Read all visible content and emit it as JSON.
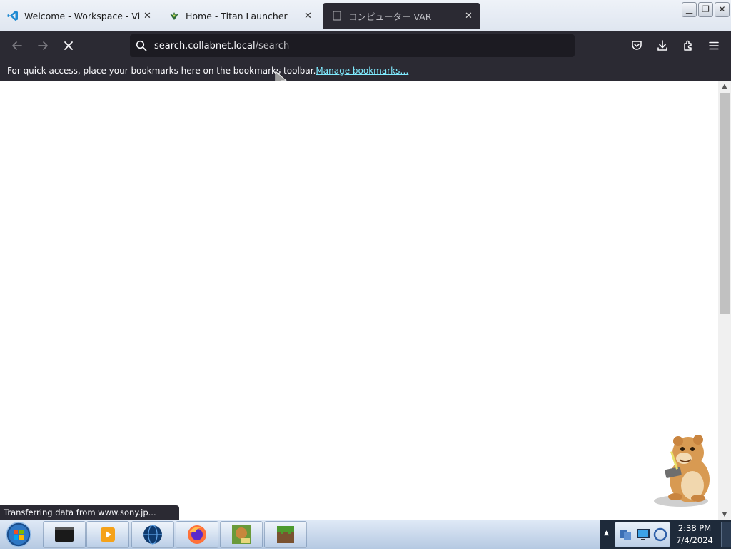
{
  "tabs": [
    {
      "title": "Welcome - Workspace - Visual",
      "icon": "vscode-icon",
      "close": "✕"
    },
    {
      "title": "Home - Titan Launcher",
      "icon": "titan-dragon-icon",
      "close": "✕"
    },
    {
      "title": "コンピューター VAR",
      "icon": "page-icon",
      "close": "✕"
    }
  ],
  "window_controls": {
    "minimize": "▁",
    "restore": "❐",
    "close": "✕"
  },
  "navigation": {
    "url_host": "search.collabnet.local",
    "url_path": "/search"
  },
  "bookmarks_bar": {
    "message": "For quick access, place your bookmarks here on the bookmarks toolbar.",
    "link": "Manage bookmarks…"
  },
  "status": {
    "text": "Transferring data from www.sony.jp..."
  },
  "taskbar": {
    "items": [
      "terminal-icon",
      "media-player-icon",
      "globe-icon",
      "firefox-icon",
      "box-game-icon",
      "minecraft-icon"
    ]
  },
  "clock": {
    "time": "2:38 PM",
    "date": "7/4/2024"
  },
  "colors": {
    "toolbar": "#2b2a33",
    "urlbar": "#1c1b22",
    "link": "#80ebff",
    "taskbar": "#c6d6ea"
  }
}
